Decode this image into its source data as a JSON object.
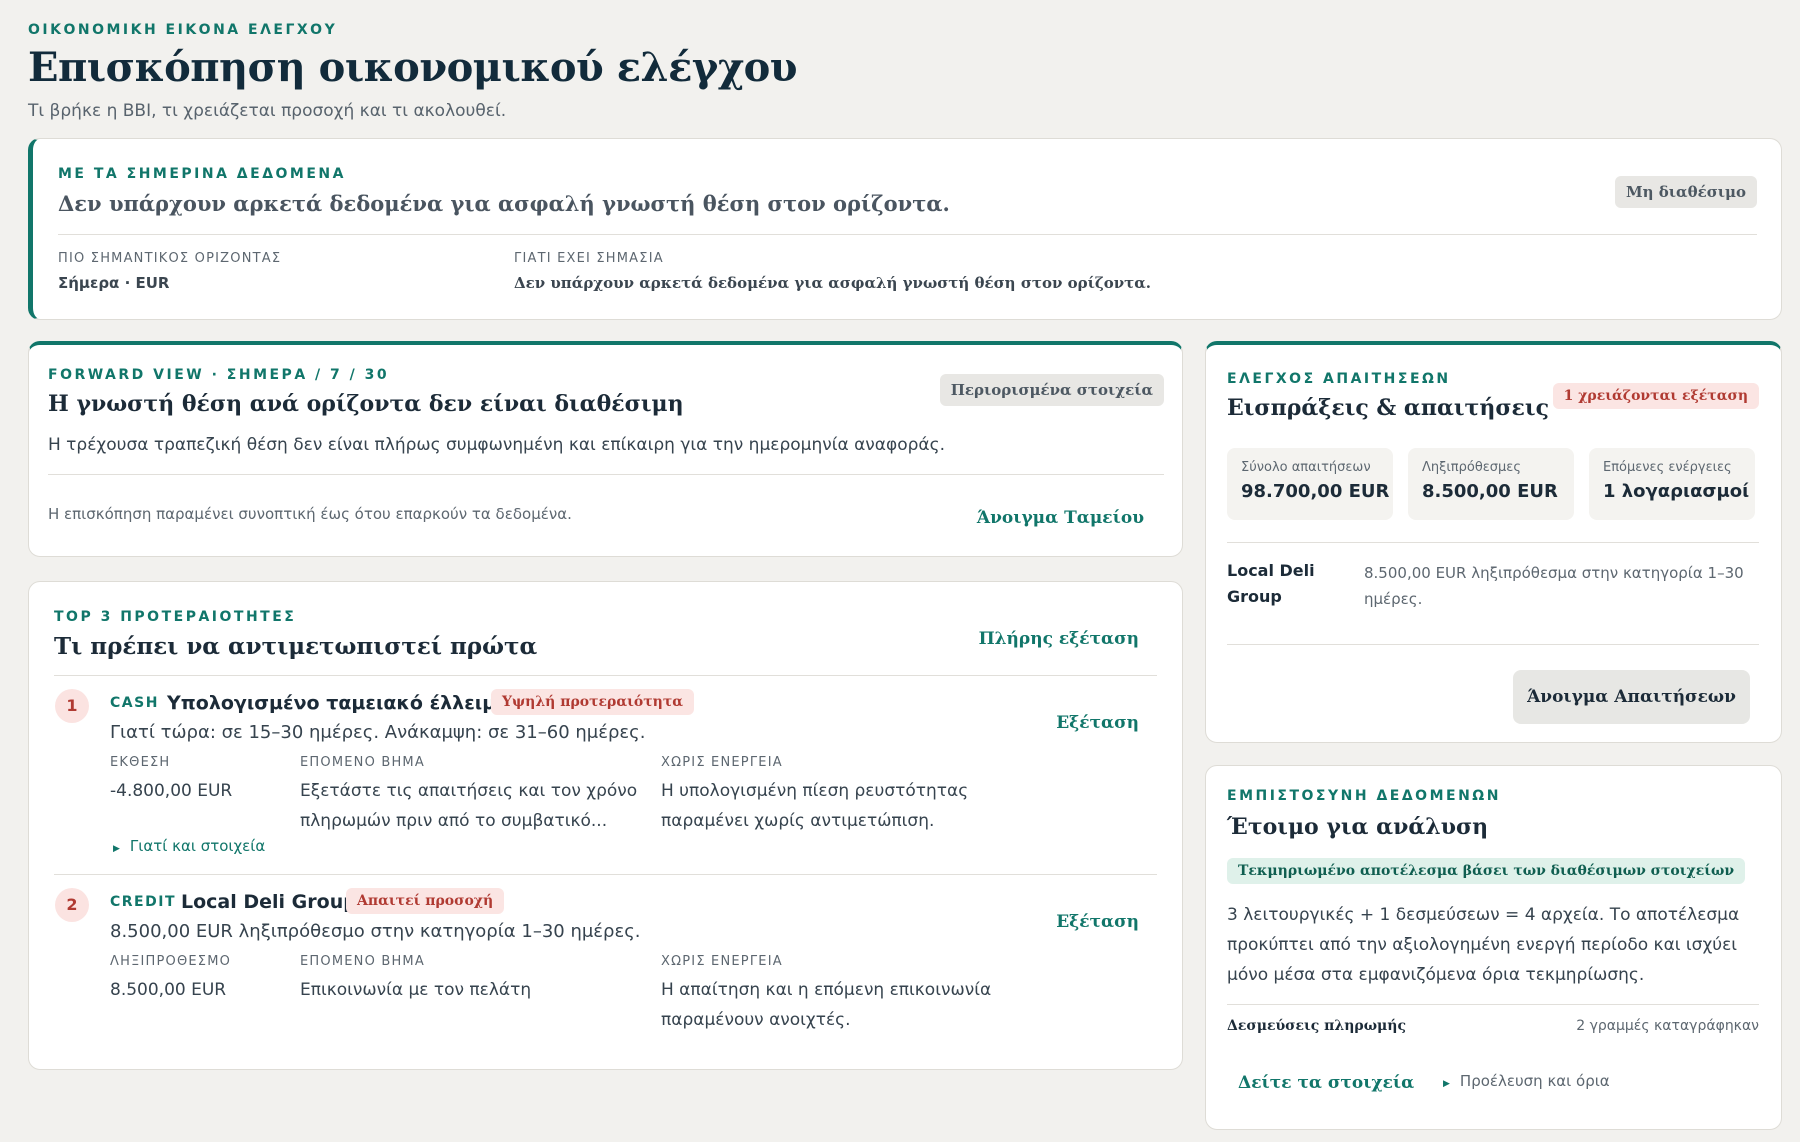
{
  "header": {
    "eyebrow": "ΟΙΚΟΝΟΜΙΚΗ ΕΙΚΟΝΑ ΕΛΕΓΧΟΥ",
    "title": "Επισκόπηση οικονομικού ελέγχου",
    "subtitle": "Τι βρήκε η BBI, τι χρειάζεται προσοχή και τι ακολουθεί."
  },
  "today_card": {
    "eyebrow": "ΜΕ ΤΑ ΣΗΜΕΡΙΝΑ ΔΕΔΟΜΕΝΑ",
    "headline": "Δεν υπάρχουν αρκετά δεδομένα για ασφαλή γνωστή θέση στον ορίζοντα.",
    "badge": "Μη διαθέσιμο",
    "horizon_label": "ΠΙΟ ΣΗΜΑΝΤΙΚΟΣ ΟΡΙΖΟΝΤΑΣ",
    "horizon_value": "Σήμερα · EUR",
    "why_label": "ΓΙΑΤΙ ΕΧΕΙ ΣΗΜΑΣΙΑ",
    "why_value": "Δεν υπάρχουν αρκετά δεδομένα για ασφαλή γνωστή θέση στον ορίζοντα."
  },
  "forward_card": {
    "eyebrow": "FORWARD VIEW · ΣΗΜΕΡΑ / 7 / 30",
    "title": "Η γνωστή θέση ανά ορίζοντα δεν είναι διαθέσιμη",
    "badge": "Περιορισμένα στοιχεία",
    "description": "Η τρέχουσα τραπεζική θέση δεν είναι πλήρως συμφωνημένη και επίκαιρη για την ημερομηνία αναφοράς.",
    "note": "Η επισκόπηση παραμένει συνοπτική έως ότου επαρκούν τα δεδομένα.",
    "link": "Άνοιγμα Ταμείου"
  },
  "priorities_card": {
    "eyebrow": "TOP 3 ΠΡΟΤΕΡΑΙΟΤΗΤΕΣ",
    "title": "Τι πρέπει να αντιμετωπιστεί πρώτα",
    "link": "Πλήρης εξέταση",
    "items": [
      {
        "number": "1",
        "category": "CASH",
        "title": "Υπολογισμένο ταμειακό έλλειμμα",
        "badge": "Υψηλή προτεραιότητα",
        "reason": "Γιατί τώρα: σε 15–30 ημέρες. Ανάκαμψη: σε 31–60 ημέρες.",
        "action": "Εξέταση",
        "col1_label": "ΕΚΘΕΣΗ",
        "col1_value": "-4.800,00 EUR",
        "col2_label": "ΕΠΟΜΕΝΟ ΒΗΜΑ",
        "col2_value": "Εξετάστε τις απαιτήσεις και τον χρόνο πληρωμών πριν από το συμβατικό...",
        "col3_label": "ΧΩΡΙΣ ΕΝΕΡΓΕΙΑ",
        "col3_value": "Η υπολογισμένη πίεση ρευστότητας παραμένει χωρίς αντιμετώπιση.",
        "details": "Γιατί και στοιχεία"
      },
      {
        "number": "2",
        "category": "CREDIT",
        "title": "Local Deli Group",
        "badge": "Απαιτεί προσοχή",
        "reason": "8.500,00 EUR ληξιπρόθεσμο στην κατηγορία 1–30 ημέρες.",
        "action": "Εξέταση",
        "col1_label": "ΛΗΞΙΠΡΟΘΕΣΜΟ",
        "col1_value": "8.500,00 EUR",
        "col2_label": "ΕΠΟΜΕΝΟ ΒΗΜΑ",
        "col2_value": "Επικοινωνία με τον πελάτη",
        "col3_label": "ΧΩΡΙΣ ΕΝΕΡΓΕΙΑ",
        "col3_value": "Η απαίτηση και η επόμενη επικοινωνία παραμένουν ανοιχτές."
      }
    ]
  },
  "receivables_card": {
    "eyebrow": "ΕΛΕΓΧΟΣ ΑΠΑΙΤΗΣΕΩΝ",
    "title": "Εισπράξεις & απαιτήσεις",
    "badge": "1 χρειάζονται εξέταση",
    "stats": [
      {
        "label": "Σύνολο απαιτήσεων",
        "value": "98.700,00 EUR"
      },
      {
        "label": "Ληξιπρόθεσμες",
        "value": "8.500,00 EUR"
      },
      {
        "label": "Επόμενες ενέργειες",
        "value": "1 λογαριασμοί"
      }
    ],
    "customer_name": "Local Deli Group",
    "customer_note": "8.500,00 EUR ληξιπρόθεσμα στην κατηγορία 1–30 ημέρες.",
    "button": "Άνοιγμα Απαιτήσεων"
  },
  "trust_card": {
    "eyebrow": "ΕΜΠΙΣΤΟΣΥΝΗ ΔΕΔΟΜΕΝΩΝ",
    "title": "Έτοιμο για ανάλυση",
    "badge": "Τεκμηριωμένο αποτέλεσμα βάσει των διαθέσιμων στοιχείων",
    "description": "3 λειτουργικές + 1 δεσμεύσεων = 4 αρχεία. Το αποτέλεσμα προκύπτει από την αξιολογημένη ενεργή περίοδο και ισχύει μόνο μέσα στα εμφανιζόμενα όρια τεκμηρίωσης.",
    "commitments_label": "Δεσμεύσεις πληρωμής",
    "commitments_value": "2 γραμμές καταγράφηκαν",
    "link": "Δείτε τα στοιχεία",
    "provenance": "Προέλευση και όρια"
  },
  "colors": {
    "accent": "#11766a",
    "danger": "#b03a32",
    "background": "#f2f1ee"
  }
}
